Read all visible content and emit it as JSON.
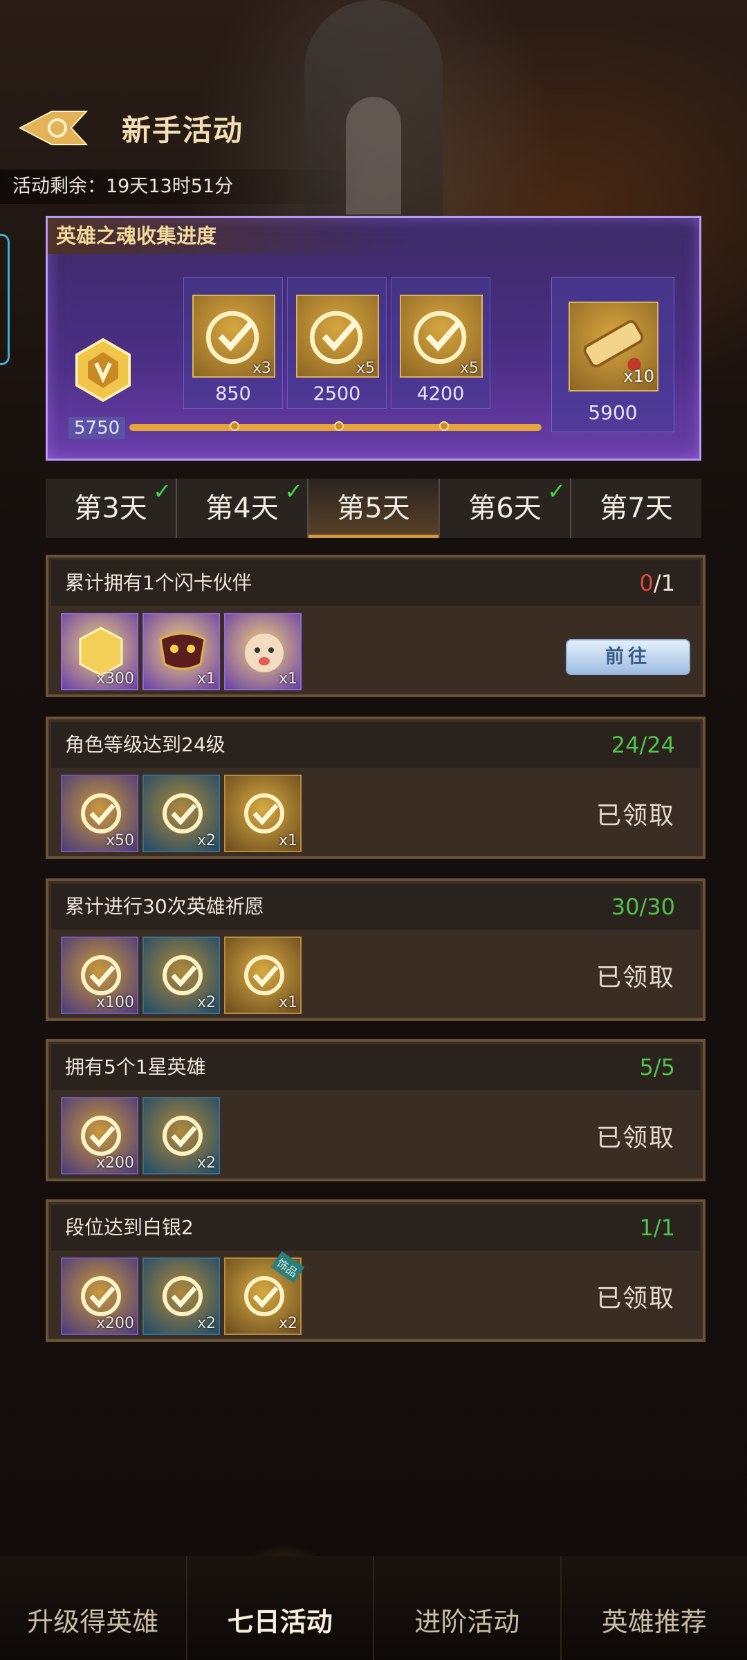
{
  "header": {
    "title": "新手活动",
    "remaining": "活动剩余：19天13时51分"
  },
  "soul_panel": {
    "title": "英雄之魂收集进度",
    "current_value": "5750",
    "milestones": [
      {
        "value": "850",
        "qty": "x3"
      },
      {
        "value": "2500",
        "qty": "x5"
      },
      {
        "value": "4200",
        "qty": "x5"
      }
    ],
    "final_reward": {
      "value": "5900",
      "qty": "x10"
    }
  },
  "day_tabs": [
    {
      "label": "第3天",
      "completed": true
    },
    {
      "label": "第4天",
      "completed": true
    },
    {
      "label": "第5天",
      "completed": false,
      "active": true
    },
    {
      "label": "第6天",
      "completed": true
    },
    {
      "label": "第7天",
      "completed": false
    }
  ],
  "tab_check": "✓",
  "tasks": [
    {
      "title": "累计拥有1个闪卡伙伴",
      "current": "0",
      "slash": "/",
      "total": "1",
      "rewards": [
        {
          "qty": "x300"
        },
        {
          "qty": "x1"
        },
        {
          "qty": "x1"
        }
      ],
      "action": "前往"
    },
    {
      "title": "角色等级达到24级",
      "current": "24",
      "slash": "/",
      "total": "24",
      "rewards": [
        {
          "qty": "x50"
        },
        {
          "qty": "x2"
        },
        {
          "qty": "x1"
        }
      ],
      "status": "已领取"
    },
    {
      "title": "累计进行30次英雄祈愿",
      "current": "30",
      "slash": "/",
      "total": "30",
      "rewards": [
        {
          "qty": "x100"
        },
        {
          "qty": "x2"
        },
        {
          "qty": "x1"
        }
      ],
      "status": "已领取"
    },
    {
      "title": "拥有5个1星英雄",
      "current": "5",
      "slash": "/",
      "total": "5",
      "rewards": [
        {
          "qty": "x200"
        },
        {
          "qty": "x2"
        }
      ],
      "status": "已领取"
    },
    {
      "title": "段位达到白银2",
      "current": "1",
      "slash": "/",
      "total": "1",
      "rewards": [
        {
          "qty": "x200"
        },
        {
          "qty": "x2"
        },
        {
          "qty": "x2",
          "tag": "饰品"
        }
      ],
      "status": "已领取"
    }
  ],
  "bottom_nav": [
    {
      "label": "升级得英雄"
    },
    {
      "label": "七日活动",
      "active": true
    },
    {
      "label": "进阶活动"
    },
    {
      "label": "英雄推荐"
    }
  ],
  "colors": {
    "accent_gold": "#e5a53a",
    "panel_purple": "#4c2f86",
    "progress_green": "#50c24e",
    "progress_red": "#e04a3a"
  }
}
